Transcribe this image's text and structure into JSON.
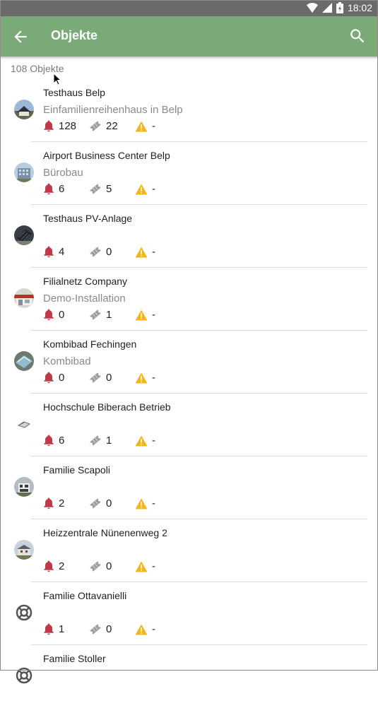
{
  "status_bar": {
    "time": "18:02"
  },
  "app_bar": {
    "title": "Objekte"
  },
  "count_label": "108 Objekte",
  "colors": {
    "appbar": "#7aaa78",
    "alarm": "#c0394b",
    "ticket": "#9e9e9e",
    "warning": "#f3b619"
  },
  "items": [
    {
      "name": "Testhaus Belp",
      "subtitle": "Einfamilienreihenhaus in Belp",
      "alarms": "128",
      "tickets": "22",
      "warnings": "-",
      "avatar": "photo-house"
    },
    {
      "name": "Airport Business Center Belp",
      "subtitle": "Bürobau",
      "alarms": "6",
      "tickets": "5",
      "warnings": "-",
      "avatar": "photo-building"
    },
    {
      "name": "Testhaus PV-Anlage",
      "subtitle": "",
      "alarms": "4",
      "tickets": "0",
      "warnings": "-",
      "avatar": "photo-solar"
    },
    {
      "name": "Filialnetz Company",
      "subtitle": "Demo-Installation",
      "alarms": "0",
      "tickets": "1",
      "warnings": "-",
      "avatar": "photo-shop"
    },
    {
      "name": "Kombibad Fechingen",
      "subtitle": "Kombibad",
      "alarms": "0",
      "tickets": "0",
      "warnings": "-",
      "avatar": "photo-pool"
    },
    {
      "name": "Hochschule Biberach Betrieb",
      "subtitle": "",
      "alarms": "6",
      "tickets": "1",
      "warnings": "-",
      "avatar": "photo-sketch"
    },
    {
      "name": "Familie Scapoli",
      "subtitle": "",
      "alarms": "2",
      "tickets": "0",
      "warnings": "-",
      "avatar": "photo-villa"
    },
    {
      "name": "Heizzentrale Nünenenweg 2",
      "subtitle": "",
      "alarms": "2",
      "tickets": "0",
      "warnings": "-",
      "avatar": "photo-plant"
    },
    {
      "name": "Familie Ottavanielli",
      "subtitle": "",
      "alarms": "1",
      "tickets": "0",
      "warnings": "-",
      "avatar": "lifebuoy-icon"
    },
    {
      "name": "Familie Stoller",
      "subtitle": "",
      "alarms": "",
      "tickets": "",
      "warnings": "",
      "avatar": "lifebuoy-icon"
    }
  ]
}
